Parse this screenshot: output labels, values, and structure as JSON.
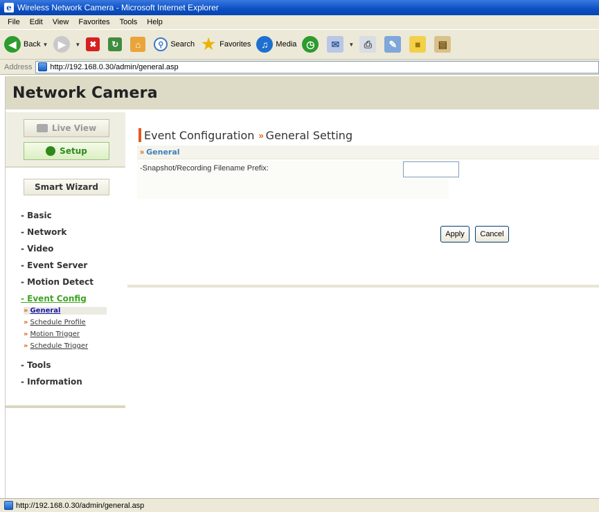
{
  "window": {
    "title": "Wireless Network Camera - Microsoft Internet Explorer"
  },
  "menubar": [
    "File",
    "Edit",
    "View",
    "Favorites",
    "Tools",
    "Help"
  ],
  "toolbar": {
    "back_label": "Back",
    "search_label": "Search",
    "favorites_label": "Favorites",
    "media_label": "Media"
  },
  "address": {
    "label": "Address",
    "url": "http://192.168.0.30/admin/general.asp"
  },
  "header": {
    "brand": "Network Camera"
  },
  "sidebar": {
    "live_view": "Live View",
    "setup": "Setup",
    "smart_wizard": "Smart Wizard",
    "items": [
      "- Basic",
      "- Network",
      "- Video",
      "- Event Server",
      "- Motion Detect",
      "- Event Config",
      "- Tools",
      "- Information"
    ],
    "sub_items": [
      "General",
      "Schedule Profile",
      "Motion Trigger",
      "Schedule Trigger"
    ]
  },
  "main": {
    "title_part1": "Event Configuration",
    "title_sep": "»",
    "title_part2": "General Setting",
    "section": "General",
    "section_chev": "»",
    "field_label": "-Snapshot/Recording Filename Prefix:",
    "field_value": "",
    "apply": "Apply",
    "cancel": "Cancel"
  },
  "status": {
    "text": "http://192.168.0.30/admin/general.asp"
  },
  "colors": {
    "accent_orange": "#e0651c",
    "active_green": "#3ea622",
    "header_bg": "#dddbc6",
    "xp_blue": "#0a4fc2"
  }
}
